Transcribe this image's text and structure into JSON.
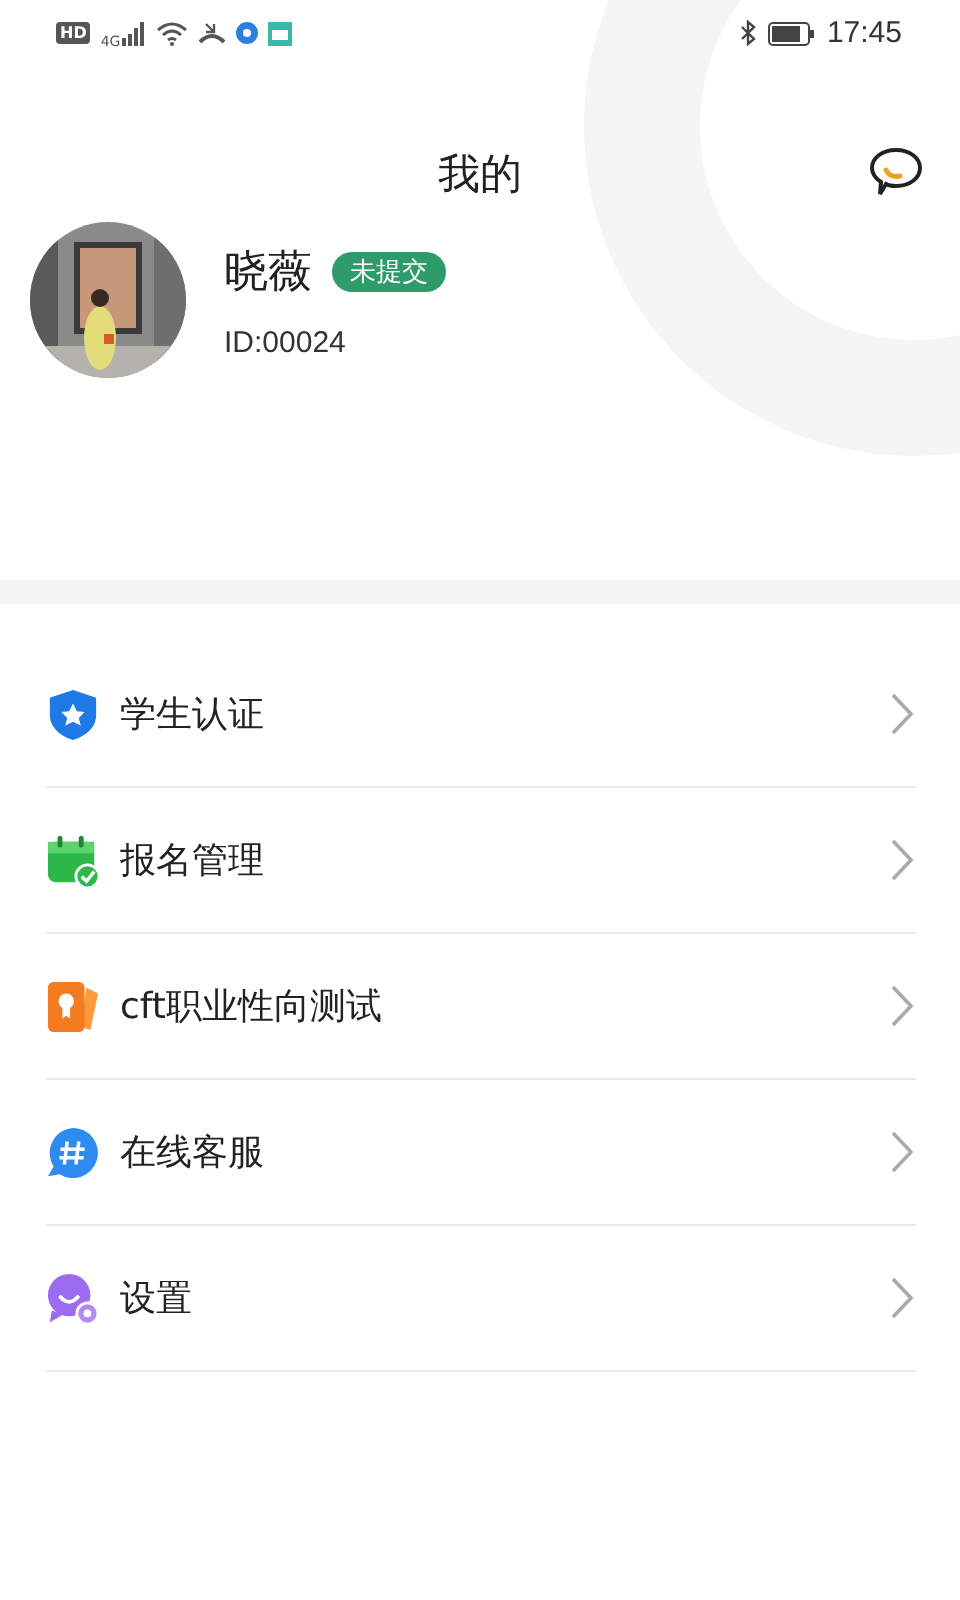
{
  "status_bar": {
    "hd": "HD",
    "network": "4G",
    "time": "17:45"
  },
  "header": {
    "title": "我的"
  },
  "profile": {
    "name": "晓薇",
    "badge": "未提交",
    "id": "ID:00024"
  },
  "menu": [
    {
      "kind": "shield",
      "label": "学生认证"
    },
    {
      "kind": "calendar",
      "label": "报名管理"
    },
    {
      "kind": "cards",
      "label": "cft职业性向测试"
    },
    {
      "kind": "chat",
      "label": "在线客服"
    },
    {
      "kind": "settings",
      "label": "设置"
    }
  ]
}
